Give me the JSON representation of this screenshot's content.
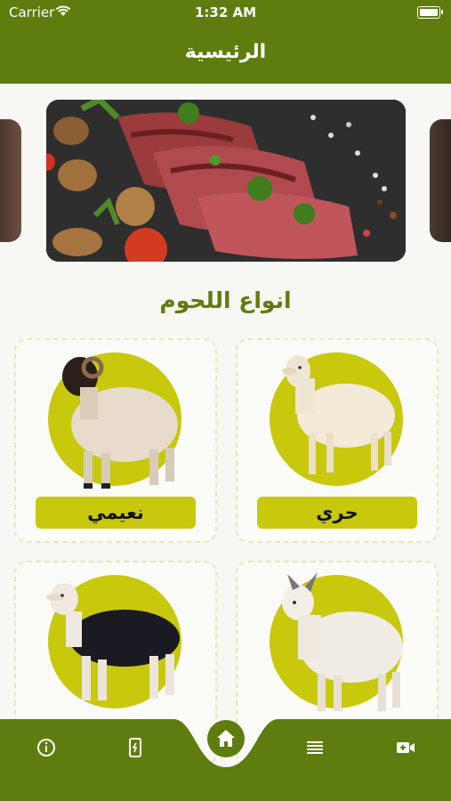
{
  "status_bar": {
    "carrier": "Carrier",
    "time": "1:32 AM"
  },
  "header": {
    "title": "الرئيسية"
  },
  "banner": {
    "slides": [
      "meat-steak-photo"
    ]
  },
  "section": {
    "title": "انواع اللحوم"
  },
  "cards": [
    {
      "label": "حري"
    },
    {
      "label": "نعيمي"
    },
    {
      "label": ""
    },
    {
      "label": ""
    }
  ],
  "nav": {
    "items": [
      "info-icon",
      "phone-icon",
      "home-icon",
      "list-icon",
      "video-icon"
    ],
    "active": "home-icon"
  },
  "colors": {
    "primary": "#5f7d0e",
    "accent": "#c8c80d",
    "background": "#f7f7f3"
  }
}
